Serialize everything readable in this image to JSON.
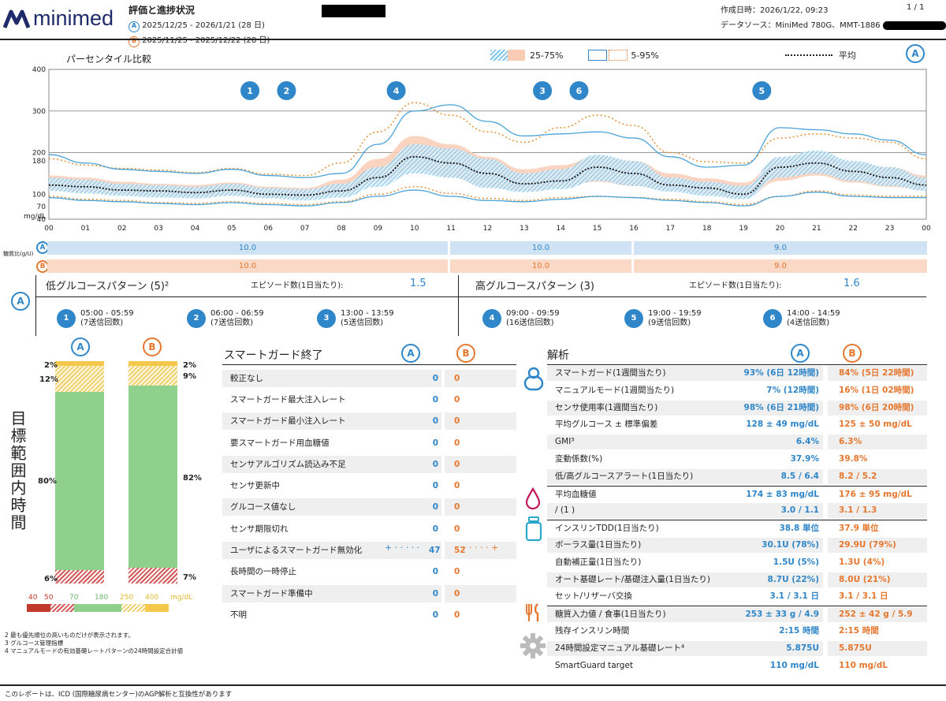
{
  "header": {
    "logo": "minimed",
    "title": "評価と進捗状況",
    "period_a": "2025/12/25 - 2026/1/21 (28 日)",
    "period_b": "2025/11/25 - 2025/12/22 (28 日)",
    "created": "作成日時：2026/1/22, 09:23",
    "page": "1 / 1",
    "source": "データソース：MiniMed 780G、MMT-1886"
  },
  "legend": {
    "chart_title": "パーセンタイル比較",
    "iqr": "25-75%",
    "range": "5-95%",
    "mean": "平均",
    "a": "A",
    "b": "B"
  },
  "chart_data": {
    "type": "line",
    "title": "パーセンタイル比較",
    "ylabel": "mg/dL",
    "ylim": [
      40,
      400
    ],
    "yticks": [
      "400",
      "300",
      "200",
      "180",
      "100",
      "70",
      "40"
    ],
    "xticks": [
      "00",
      "01",
      "02",
      "03",
      "04",
      "05",
      "06",
      "07",
      "08",
      "09",
      "10",
      "11",
      "12",
      "13",
      "14",
      "15",
      "16",
      "17",
      "18",
      "19",
      "20",
      "21",
      "22",
      "23",
      "00"
    ],
    "x_hours": [
      0,
      1,
      2,
      3,
      4,
      5,
      6,
      7,
      8,
      9,
      10,
      11,
      12,
      13,
      14,
      15,
      16,
      17,
      18,
      19,
      20,
      21,
      22,
      23,
      24
    ],
    "series": [
      {
        "name": "A",
        "label": "平均",
        "values": [
          122,
          118,
          110,
          108,
          104,
          110,
          100,
          98,
          108,
          140,
          190,
          175,
          150,
          125,
          132,
          165,
          150,
          122,
          115,
          100,
          165,
          175,
          155,
          140,
          122
        ]
      },
      {
        "name": "A",
        "label": "25%",
        "values": [
          108,
          102,
          96,
          92,
          90,
          96,
          90,
          85,
          92,
          118,
          150,
          140,
          115,
          105,
          112,
          132,
          120,
          106,
          96,
          88,
          140,
          150,
          132,
          120,
          108
        ]
      },
      {
        "name": "A",
        "label": "75%",
        "values": [
          140,
          135,
          125,
          122,
          118,
          125,
          115,
          112,
          125,
          165,
          220,
          210,
          185,
          150,
          160,
          195,
          180,
          140,
          130,
          120,
          190,
          205,
          180,
          165,
          140
        ]
      },
      {
        "name": "A",
        "label": "5%",
        "values": [
          92,
          85,
          82,
          78,
          75,
          80,
          75,
          72,
          80,
          95,
          110,
          95,
          85,
          82,
          88,
          95,
          92,
          85,
          80,
          72,
          95,
          105,
          95,
          92,
          92
        ]
      },
      {
        "name": "A",
        "label": "95%",
        "values": [
          195,
          175,
          160,
          155,
          150,
          160,
          145,
          140,
          150,
          220,
          300,
          315,
          275,
          240,
          245,
          250,
          235,
          190,
          165,
          170,
          260,
          255,
          245,
          230,
          195
        ]
      },
      {
        "name": "B",
        "label": "平均",
        "values": [
          125,
          122,
          115,
          112,
          110,
          112,
          104,
          102,
          115,
          158,
          200,
          182,
          155,
          130,
          140,
          160,
          150,
          128,
          118,
          108,
          160,
          170,
          150,
          140,
          125
        ]
      },
      {
        "name": "B",
        "label": "25%",
        "values": [
          110,
          105,
          100,
          96,
          94,
          98,
          92,
          90,
          98,
          130,
          160,
          140,
          118,
          108,
          118,
          130,
          120,
          110,
          100,
          92,
          132,
          145,
          128,
          118,
          110
        ]
      },
      {
        "name": "B",
        "label": "75%",
        "values": [
          145,
          140,
          130,
          125,
          122,
          128,
          118,
          115,
          135,
          185,
          240,
          220,
          190,
          160,
          170,
          190,
          180,
          150,
          138,
          128,
          185,
          195,
          175,
          165,
          145
        ]
      },
      {
        "name": "B",
        "label": "5%",
        "values": [
          95,
          88,
          85,
          80,
          78,
          82,
          78,
          75,
          82,
          100,
          118,
          102,
          90,
          85,
          92,
          95,
          92,
          88,
          82,
          75,
          95,
          108,
          98,
          95,
          95
        ]
      },
      {
        "name": "B",
        "label": "95%",
        "values": [
          185,
          170,
          162,
          158,
          152,
          162,
          148,
          145,
          175,
          250,
          320,
          290,
          250,
          225,
          260,
          290,
          265,
          200,
          178,
          175,
          235,
          245,
          235,
          225,
          185
        ]
      }
    ],
    "markers": [
      {
        "n": "1",
        "x": 5.5
      },
      {
        "n": "2",
        "x": 6.5
      },
      {
        "n": "4",
        "x": 9.5
      },
      {
        "n": "3",
        "x": 13.5
      },
      {
        "n": "6",
        "x": 14.5
      },
      {
        "n": "5",
        "x": 19.5
      }
    ]
  },
  "carb_ratio": {
    "label": "糖質比(g/U)",
    "a": [
      {
        "val": "10.0"
      },
      {
        "val": "10.0"
      },
      {
        "val": "9.0"
      }
    ],
    "b": [
      {
        "val": "10.0"
      },
      {
        "val": "10.0"
      },
      {
        "val": "9.0"
      }
    ]
  },
  "patterns": {
    "low_title": "低グルコースパターン (5)²",
    "low_ep_label": "エピソード数(1日当たり):",
    "low_ep_val": "1.5",
    "high_title": "高グルコースパターン (3)",
    "high_ep_label": "エピソード数(1日当たり):",
    "high_ep_val": "1.6",
    "low_items": [
      {
        "n": "1",
        "time": "05:00 - 05:59",
        "count": "(7送信回数)"
      },
      {
        "n": "2",
        "time": "06:00 - 06:59",
        "count": "(7送信回数)"
      },
      {
        "n": "3",
        "time": "13:00 - 13:59",
        "count": "(5送信回数)"
      }
    ],
    "high_items": [
      {
        "n": "4",
        "time": "09:00 - 09:59",
        "count": "(16送信回数)"
      },
      {
        "n": "5",
        "time": "19:00 - 19:59",
        "count": "(9送信回数)"
      },
      {
        "n": "6",
        "time": "14:00 - 14:59",
        "count": "(4送信回数)"
      }
    ]
  },
  "tir": {
    "vertical_label": "目標範囲内時間",
    "a": {
      "very_high": "2%",
      "high": "12%",
      "in": "80%",
      "low": "6%",
      "fractions": [
        0.02,
        0.12,
        0.8,
        0.06
      ]
    },
    "b": {
      "very_high": "2%",
      "high": "9%",
      "in": "82%",
      "low": "7%",
      "fractions": [
        0.02,
        0.09,
        0.82,
        0.07
      ]
    },
    "scale": [
      "40",
      "50",
      "70",
      "180",
      "250",
      "400",
      "mg/dL"
    ]
  },
  "footnotes": [
    "2 最も優先順位の高いものだけが表示されます。",
    "3 グルコース管理指標",
    "4 マニュアルモードの有効基礎レートパターンの24時間設定合計値"
  ],
  "footer": "このレポートは、ICD (国際糖尿病センター)のAGP解析と互換性があります",
  "smartguard": {
    "title": "スマートガード終了",
    "rows": [
      {
        "label": "較正なし",
        "a": "0",
        "b": "0"
      },
      {
        "label": "スマートガード最大注入レート",
        "a": "0",
        "b": "0"
      },
      {
        "label": "スマートガード最小注入レート",
        "a": "0",
        "b": "0"
      },
      {
        "label": "要スマートガード用血糖値",
        "a": "0",
        "b": "0"
      },
      {
        "label": "センサアルゴリズム読込み不足",
        "a": "0",
        "b": "0"
      },
      {
        "label": "センサ更新中",
        "a": "0",
        "b": "0"
      },
      {
        "label": "グルコース値なし",
        "a": "0",
        "b": "0"
      },
      {
        "label": "センサ期限切れ",
        "a": "0",
        "b": "0"
      },
      {
        "label": "ユーザによるスマートガード無効化",
        "a": "47",
        "b": "52"
      },
      {
        "label": "長時間の一時停止",
        "a": "0",
        "b": "0"
      },
      {
        "label": "スマートガード準備中",
        "a": "0",
        "b": "0"
      },
      {
        "label": "不明",
        "a": "0",
        "b": "0"
      }
    ]
  },
  "analysis": {
    "title": "解析",
    "rows": [
      {
        "label": "スマートガード(1週間当たり)",
        "a": "93% (6日 12時間)",
        "b": "84% (5日 22時間)"
      },
      {
        "label": "マニュアルモード(1週間当たり)",
        "a": "7% (12時間)",
        "b": "16% (1日 02時間)"
      },
      {
        "label": "センサ使用率(1週間当たり)",
        "a": "98% (6日 21時間)",
        "b": "98% (6日 20時間)"
      },
      {
        "label": "平均グルコース ± 標準偏差",
        "a": "128 ± 49 mg/dL",
        "b": "125 ± 50 mg/dL"
      },
      {
        "label": "GMI³",
        "a": "6.4%",
        "b": "6.3%"
      },
      {
        "label": "変動係数(%)",
        "a": "37.9%",
        "b": "39.8%"
      },
      {
        "label": "低/高グルコースアラート(1日当たり)",
        "a": "8.5 / 6.4",
        "b": "8.2 / 5.2"
      },
      {
        "label": "平均血糖値",
        "a": "174 ± 83 mg/dL",
        "b": "176 ± 95 mg/dL"
      },
      {
        "label": "/ (1 )",
        "a": "3.0 / 1.1",
        "b": "3.1 / 1.3"
      },
      {
        "label": "インスリンTDD(1日当たり)",
        "a": "38.8 単位",
        "b": "37.9 単位"
      },
      {
        "label": "ボーラス量(1日当たり)",
        "a": "30.1U (78%)",
        "b": "29.9U (79%)"
      },
      {
        "label": "自動補正量(1日当たり)",
        "a": "1.5U (5%)",
        "b": "1.3U (4%)"
      },
      {
        "label": "オート基礎レート/基礎注入量(1日当たり)",
        "a": "8.7U (22%)",
        "b": "8.0U (21%)"
      },
      {
        "label": "セット/リザーバ交換",
        "a": "3.1 / 3.1 日",
        "b": "3.1 / 3.1 日"
      },
      {
        "label": "糖質入力値 / 食事(1日当たり)",
        "a": "253 ± 33 g / 4.9",
        "b": "252 ± 42 g / 5.9"
      },
      {
        "label": "残存インスリン時間",
        "a": "2:15 時間",
        "b": "2:15 時間"
      },
      {
        "label": "24時間設定マニュアル基礎レート⁴",
        "a": "5.875U",
        "b": "5.875U"
      },
      {
        "label": "SmartGuard target",
        "a": "110 mg/dL",
        "b": "110 mg/dL"
      }
    ]
  }
}
